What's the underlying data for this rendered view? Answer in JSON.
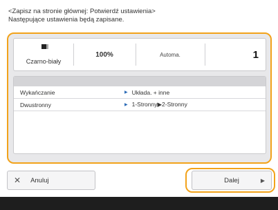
{
  "header": {
    "line1": "<Zapisz na stronie głównej: Potwierdź ustawienia>",
    "line2": "Następujące ustawienia będą zapisane."
  },
  "summary": {
    "color_mode": "Czarno-biały",
    "color_icon": "bw-page-icon",
    "zoom": "100%",
    "mode": "Automa.",
    "copies": "1"
  },
  "settings_list": [
    {
      "label": "Wykańczanie",
      "value": "Układa. + inne"
    },
    {
      "label": "Dwustronny",
      "value": "1-Stronny▶2-Stronny"
    }
  ],
  "buttons": {
    "cancel_label": "Anuluj",
    "cancel_icon": "close-icon",
    "next_label": "Dalej",
    "next_icon": "triangle-right-icon"
  },
  "colors": {
    "highlight": "#f2a21a",
    "arrow": "#2a6ab6",
    "footer": "#1e1e1e"
  }
}
